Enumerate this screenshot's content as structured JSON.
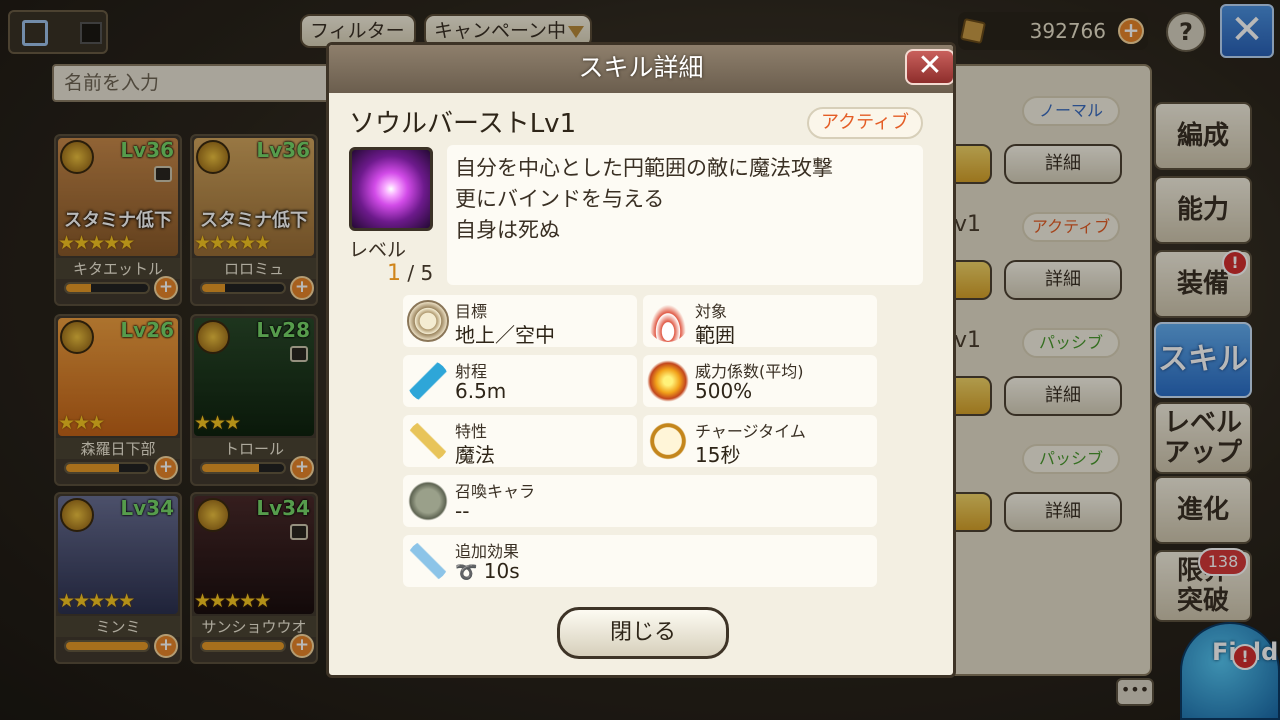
{
  "top": {
    "filter_label": "フィルター",
    "campaign_label": "キャンペーン中",
    "search_placeholder": "名前を入力",
    "currency_value": "392766",
    "help_label": "?"
  },
  "characters": [
    {
      "level": "Lv36",
      "status": "スタミナ低下",
      "name": "キタエットル",
      "stars": "★★★★★",
      "progress": 0.3
    },
    {
      "level": "Lv36",
      "status": "スタミナ低下",
      "name": "ロロミュ",
      "stars": "★★★★★",
      "progress": 0.28
    },
    {
      "level": "Lv26",
      "status": "",
      "name": "森羅日下部",
      "stars": "★★★",
      "progress": 0.65
    },
    {
      "level": "Lv28",
      "status": "",
      "name": "トロール",
      "stars": "★★★",
      "progress": 0.7
    },
    {
      "level": "Lv34",
      "status": "",
      "name": "ミンミ",
      "stars": "★★★★★",
      "progress": 1.0
    },
    {
      "level": "Lv34",
      "status": "",
      "name": "サンショウウオ",
      "stars": "★★★★★",
      "progress": 1.0
    }
  ],
  "right_panel": {
    "rows": [
      {
        "tag": "ノーマル",
        "level": "",
        "detail": "詳細"
      },
      {
        "tag": "アクティブ",
        "level": "v1",
        "detail": "詳細"
      },
      {
        "tag": "パッシブ",
        "level": "v1",
        "detail": "詳細"
      },
      {
        "tag": "パッシブ",
        "level": "",
        "detail": "詳細"
      }
    ]
  },
  "side_tabs": [
    "編成",
    "能力",
    "装備",
    "スキル",
    "レベルアップ",
    "進化",
    "限界突破"
  ],
  "side_tabs_split": {
    "levelup_1": "レベル",
    "levelup_2": "アップ",
    "limit_1": "限界",
    "limit_2": "突破"
  },
  "active_tab": "スキル",
  "alerts": {
    "equip": "!",
    "field": "!",
    "count": "138"
  },
  "field_label": "Field",
  "modal": {
    "title": "スキル詳細",
    "skill_name": "ソウルバーストLv1",
    "skill_type": "アクティブ",
    "level_label": "レベル",
    "level_current": "1",
    "level_max": "/ 5",
    "description": [
      "自分を中心とした円範囲の敵に魔法攻撃",
      "更にバインドを与える",
      "自身は死ぬ"
    ],
    "info": {
      "target": {
        "label": "目標",
        "value": "地上／空中"
      },
      "scope": {
        "label": "対象",
        "value": "範囲"
      },
      "range": {
        "label": "射程",
        "value": "6.5m"
      },
      "power": {
        "label": "威力係数(平均)",
        "value": "500%"
      },
      "trait": {
        "label": "特性",
        "value": "魔法"
      },
      "charge": {
        "label": "チャージタイム",
        "value": "15秒"
      },
      "summon": {
        "label": "召喚キャラ",
        "value": "--"
      },
      "extra": {
        "label": "追加効果",
        "value": "10s"
      }
    },
    "close_label": "閉じる"
  },
  "colors": {
    "accent_blue": "#2b6fc8",
    "active_tag": "#e45d26",
    "level_number": "#d0851a"
  }
}
